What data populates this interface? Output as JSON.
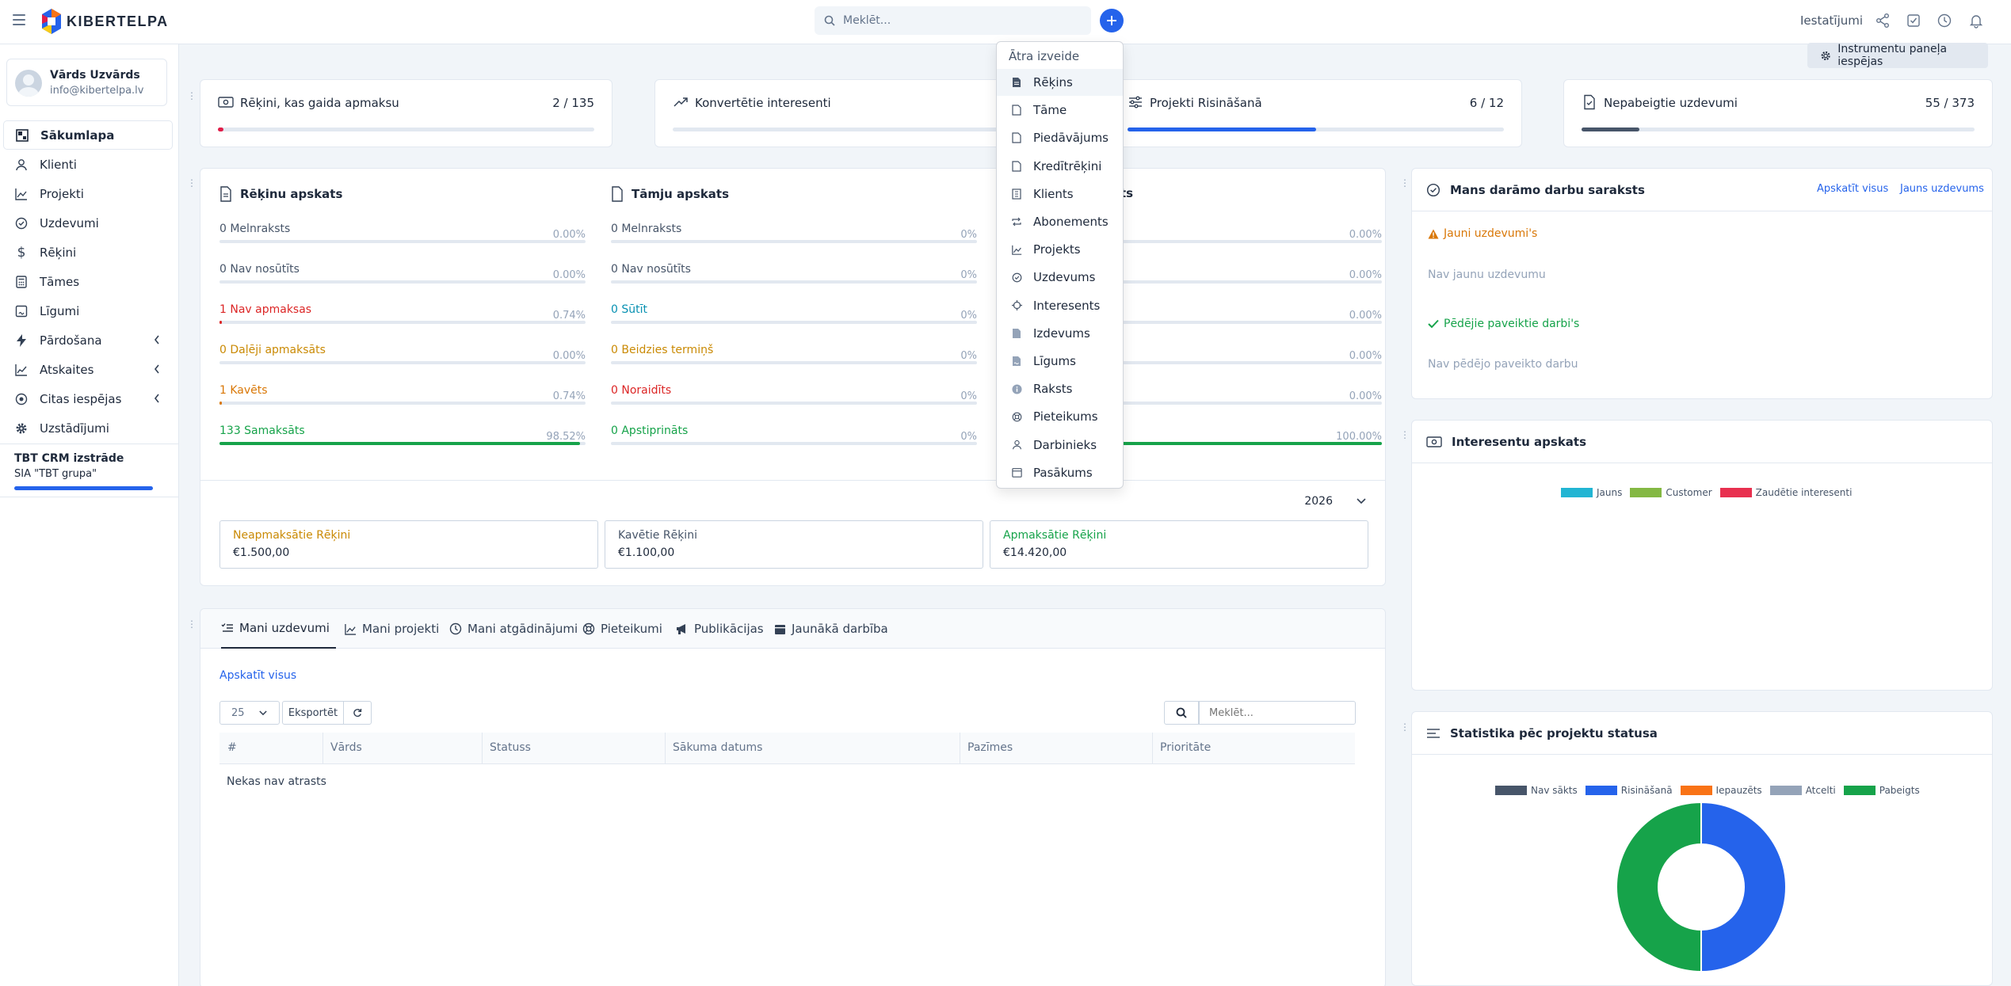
{
  "topbar": {
    "logo_text": "KIBERTELPA",
    "search_placeholder": "Meklēt...",
    "settings_label": "Iestatījumi"
  },
  "user": {
    "name": "Vārds Uzvārds",
    "email": "info@kibertelpa.lv"
  },
  "sidebar": {
    "items": [
      {
        "label": "Sākumlapa",
        "icon": "dashboard-icon"
      },
      {
        "label": "Klienti",
        "icon": "user-icon"
      },
      {
        "label": "Projekti",
        "icon": "chart-icon"
      },
      {
        "label": "Uzdevumi",
        "icon": "check-circle-icon"
      },
      {
        "label": "Rēķini",
        "icon": "dollar-icon"
      },
      {
        "label": "Tāmes",
        "icon": "calculator-icon"
      },
      {
        "label": "Līgumi",
        "icon": "contract-icon"
      },
      {
        "label": "Pārdošana",
        "icon": "bolt-icon"
      },
      {
        "label": "Atskaites",
        "icon": "line-chart-icon"
      },
      {
        "label": "Citas iespējas",
        "icon": "circle-dot-icon"
      },
      {
        "label": "Uzstādījumi",
        "icon": "gear-icon"
      }
    ],
    "company_title": "TBT CRM izstrāde",
    "company_sub": "SIA \"TBT grupa\""
  },
  "panel_options_label": "Instrumentu paneļa iespējas",
  "stats": [
    {
      "title": "Rēķini, kas gaida apmaksu",
      "value": "2 / 135",
      "progress": 0.015,
      "color": "#e11d48"
    },
    {
      "title": "Konvertētie interesenti",
      "value": "",
      "progress": 0.0,
      "color": "#2563eb"
    },
    {
      "title": "Projekti Risināšanā",
      "value": "6 / 12",
      "progress": 0.5,
      "color": "#2563eb"
    },
    {
      "title": "Nepabeigtie uzdevumi",
      "value": "55 / 373",
      "progress": 0.147,
      "color": "#475569"
    }
  ],
  "overview": {
    "invoices": {
      "title": "Rēķinu apskats",
      "rows": [
        {
          "label": "0 Melnraksts",
          "pct": "0.00%",
          "fill": 0.0,
          "color": "#64748b"
        },
        {
          "label": "0 Nav nosūtīts",
          "pct": "0.00%",
          "fill": 0.0,
          "color": "#64748b"
        },
        {
          "label": "1 Nav apmaksas",
          "pct": "0.74%",
          "fill": 0.0074,
          "color": "#dc2626"
        },
        {
          "label": "0 Daļēji apmaksāts",
          "pct": "0.00%",
          "fill": 0.0,
          "color": "#ca8a04"
        },
        {
          "label": "1 Kavēts",
          "pct": "0.74%",
          "fill": 0.0074,
          "color": "#d97706"
        },
        {
          "label": "133 Samaksāts",
          "pct": "98.52%",
          "fill": 0.9852,
          "color": "#16a34a"
        }
      ]
    },
    "estimates": {
      "title": "Tāmju apskats",
      "rows": [
        {
          "label": "0 Melnraksts",
          "pct": "0%",
          "fill": 0.0,
          "color": "#64748b"
        },
        {
          "label": "0 Nav nosūtīts",
          "pct": "0%",
          "fill": 0.0,
          "color": "#64748b"
        },
        {
          "label": "0 Sūtīt",
          "pct": "0%",
          "fill": 0.0,
          "color": "#0891b2"
        },
        {
          "label": "0 Beidzies termiņš",
          "pct": "0%",
          "fill": 0.0,
          "color": "#ca8a04"
        },
        {
          "label": "0 Noraidīts",
          "pct": "0%",
          "fill": 0.0,
          "color": "#dc2626"
        },
        {
          "label": "0 Apstiprināts",
          "pct": "0%",
          "fill": 0.0,
          "color": "#16a34a"
        }
      ]
    },
    "third": {
      "title_partial": "ts",
      "pcts": [
        "0.00%",
        "0.00%",
        "0.00%",
        "0.00%",
        "0.00%",
        "100.00%"
      ],
      "fills": [
        0,
        0,
        0,
        0,
        0,
        1.0
      ]
    },
    "year": "2026",
    "summaries": [
      {
        "label": "Neapmaksātie Rēķini",
        "value": "€1.500,00",
        "color": "#ca8a04"
      },
      {
        "label": "Kavētie Rēķini",
        "value": "€1.100,00",
        "color": "#475569"
      },
      {
        "label": "Apmaksātie Rēķini",
        "value": "€14.420,00",
        "color": "#16a34a"
      }
    ]
  },
  "tabs": {
    "items": [
      {
        "label": "Mani uzdevumi",
        "icon": "task-list-icon"
      },
      {
        "label": "Mani projekti",
        "icon": "chart-icon"
      },
      {
        "label": "Mani atgādinājumi",
        "icon": "clock-icon"
      },
      {
        "label": "Pieteikumi",
        "icon": "lifebuoy-icon"
      },
      {
        "label": "Publikācijas",
        "icon": "megaphone-icon"
      },
      {
        "label": "Jaunākā darbība",
        "icon": "calendar-icon"
      }
    ],
    "view_all": "Apskatīt visus",
    "page_size": "25",
    "export": "Eksportēt",
    "search_placeholder": "Meklēt...",
    "columns": [
      "#",
      "Vārds",
      "Statuss",
      "Sākuma datums",
      "Pazīmes",
      "Prioritāte"
    ],
    "empty": "Nekas nav atrasts"
  },
  "todo": {
    "title": "Mans darāmo darbu saraksts",
    "view_all": "Apskatīt visus",
    "new_task": "Jauns uzdevums",
    "new_heading": "Jauni uzdevumi's",
    "new_empty": "Nav jaunu uzdevumu",
    "done_heading": "Pēdējie paveiktie darbi's",
    "done_empty": "Nav pēdējo paveikto darbu"
  },
  "interests": {
    "title": "Interesentu apskats",
    "legend": [
      {
        "name": "Jauns",
        "color": "#22b5d3"
      },
      {
        "name": "Customer",
        "color": "#84b843"
      },
      {
        "name": "Zaudētie interesenti",
        "color": "#e8304f"
      }
    ]
  },
  "status_stats": {
    "title": "Statistika pēc projektu statusa",
    "legend": [
      {
        "name": "Nav sākts",
        "color": "#475569"
      },
      {
        "name": "Risināšanā",
        "color": "#2563eb"
      },
      {
        "name": "Iepauzēts",
        "color": "#f97316"
      },
      {
        "name": "Atcelti",
        "color": "#94a3b8"
      },
      {
        "name": "Pabeigts",
        "color": "#16a34a"
      }
    ],
    "chart_data": {
      "type": "pie",
      "variant": "doughnut",
      "labels": [
        "Nav sākts",
        "Risināšanā",
        "Iepauzēts",
        "Atcelti",
        "Pabeigts"
      ],
      "values": [
        0,
        6,
        0,
        0,
        6
      ]
    }
  },
  "quick_create": {
    "header": "Ātra izveide",
    "items": [
      {
        "label": "Rēķins",
        "icon": "invoice-icon"
      },
      {
        "label": "Tāme",
        "icon": "document-icon"
      },
      {
        "label": "Piedāvājums",
        "icon": "document-icon"
      },
      {
        "label": "Kredītrēķini",
        "icon": "document-icon"
      },
      {
        "label": "Klients",
        "icon": "building-icon"
      },
      {
        "label": "Abonements",
        "icon": "repeat-icon"
      },
      {
        "label": "Projekts",
        "icon": "chart-icon"
      },
      {
        "label": "Uzdevums",
        "icon": "check-circle-icon"
      },
      {
        "label": "Interesents",
        "icon": "crosshair-icon"
      },
      {
        "label": "Izdevums",
        "icon": "receipt-icon"
      },
      {
        "label": "Līgums",
        "icon": "contract-icon"
      },
      {
        "label": "Raksts",
        "icon": "info-icon"
      },
      {
        "label": "Pieteikums",
        "icon": "lifebuoy-icon"
      },
      {
        "label": "Darbinieks",
        "icon": "user-icon"
      },
      {
        "label": "Pasākums",
        "icon": "calendar-icon"
      }
    ]
  }
}
